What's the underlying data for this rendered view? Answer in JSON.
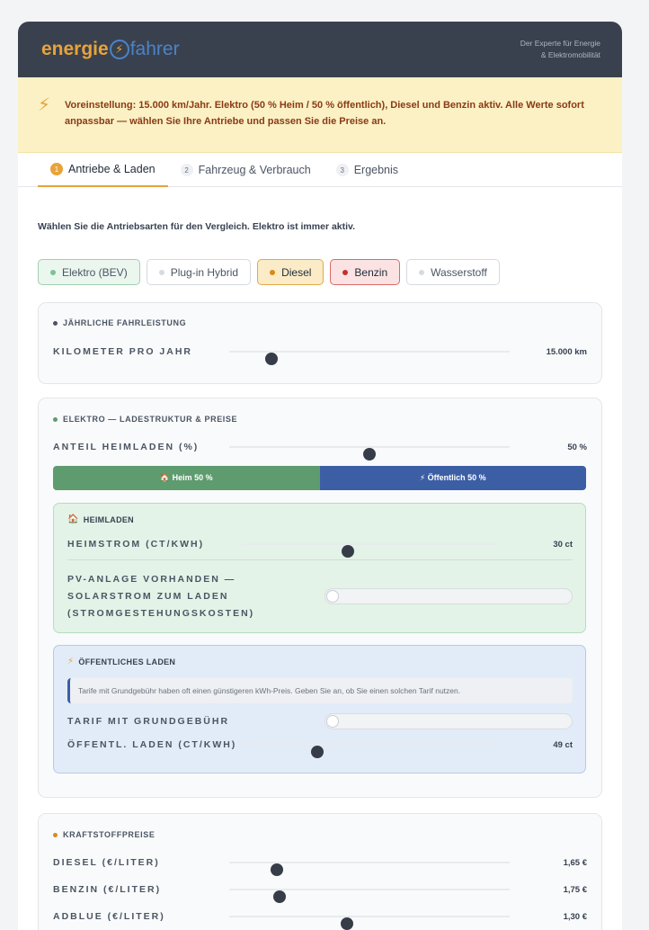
{
  "header": {
    "logo_part1": "energie",
    "logo_part2": "fahrer",
    "tagline_line1": "Der Experte für Energie",
    "tagline_line2": "& Elektromobilität"
  },
  "banner": {
    "text": "Voreinstellung: 15.000 km/Jahr. Elektro (50 % Heim / 50 % öffentlich), Diesel und Benzin aktiv. Alle Werte sofort anpassbar — wählen Sie Ihre Antriebe und passen Sie die Preise an."
  },
  "tabs": [
    {
      "num": "1",
      "label": "Antriebe & Laden",
      "active": true
    },
    {
      "num": "2",
      "label": "Fahrzeug & Verbrauch",
      "active": false
    },
    {
      "num": "3",
      "label": "Ergebnis",
      "active": false
    }
  ],
  "intro": "Wählen Sie die Antriebsarten für den Vergleich. Elektro ist immer aktiv.",
  "drives": [
    {
      "label": "Elektro (BEV)",
      "dot": "#7cc293",
      "state": "active"
    },
    {
      "label": "Plug-in Hybrid",
      "dot": "#d7dade",
      "state": "off"
    },
    {
      "label": "Diesel",
      "dot": "#d98a1c",
      "state": "on"
    },
    {
      "label": "Benzin",
      "dot": "#c62f2f",
      "state": "on"
    },
    {
      "label": "Wasserstoff",
      "dot": "#d7dade",
      "state": "off"
    }
  ],
  "mileage": {
    "title": "JÄHRLICHE FAHRLEISTUNG",
    "dot": "#4b5563",
    "label": "KILOMETER PRO JAHR",
    "value": "15.000 km",
    "level": 0.15
  },
  "electric": {
    "title": "ELEKTRO — LADESTRUKTUR & PREISE",
    "dot": "#5e9b6f",
    "home_share_label": "ANTEIL HEIMLADEN (%)",
    "home_share_value": "50 %",
    "home_share_level": 0.5,
    "split_home": "🏠 Heim 50 %",
    "split_public": "⚡ Öffentlich 50 %",
    "home": {
      "title": "HEIMLADEN",
      "icon": "house-icon",
      "price_label": "HEIMSTROM (CT/KWH)",
      "price_value": "30 ct",
      "price_level": 0.41,
      "pv_label_line1": "PV-ANLAGE VORHANDEN —",
      "pv_label_line2": "SOLARSTROM ZUM LADEN",
      "pv_label_line3": "(STROMGESTEHUNGSKOSTEN)",
      "pv_on": false
    },
    "public": {
      "title": "ÖFFENTLICHES LADEN",
      "icon": "bolt-icon",
      "info": "Tarife mit Grundgebühr haben oft einen günstigeren kWh-Preis. Geben Sie an, ob Sie einen solchen Tarif nutzen.",
      "tariff_label": "TARIF MIT GRUNDGEBÜHR",
      "tariff_on": false,
      "price_label": "ÖFFENTL. LADEN (CT/KWH)",
      "price_value": "49 ct",
      "price_level": 0.29
    }
  },
  "fuel": {
    "title": "KRAFTSTOFFPREISE",
    "dot": "#d98a1c",
    "rows": [
      {
        "label": "DIESEL (€/LITER)",
        "value": "1,65 €",
        "level": 0.17
      },
      {
        "label": "BENZIN (€/LITER)",
        "value": "1,75 €",
        "level": 0.18
      },
      {
        "label": "ADBLUE (€/LITER)",
        "value": "1,30 €",
        "level": 0.42
      }
    ]
  }
}
